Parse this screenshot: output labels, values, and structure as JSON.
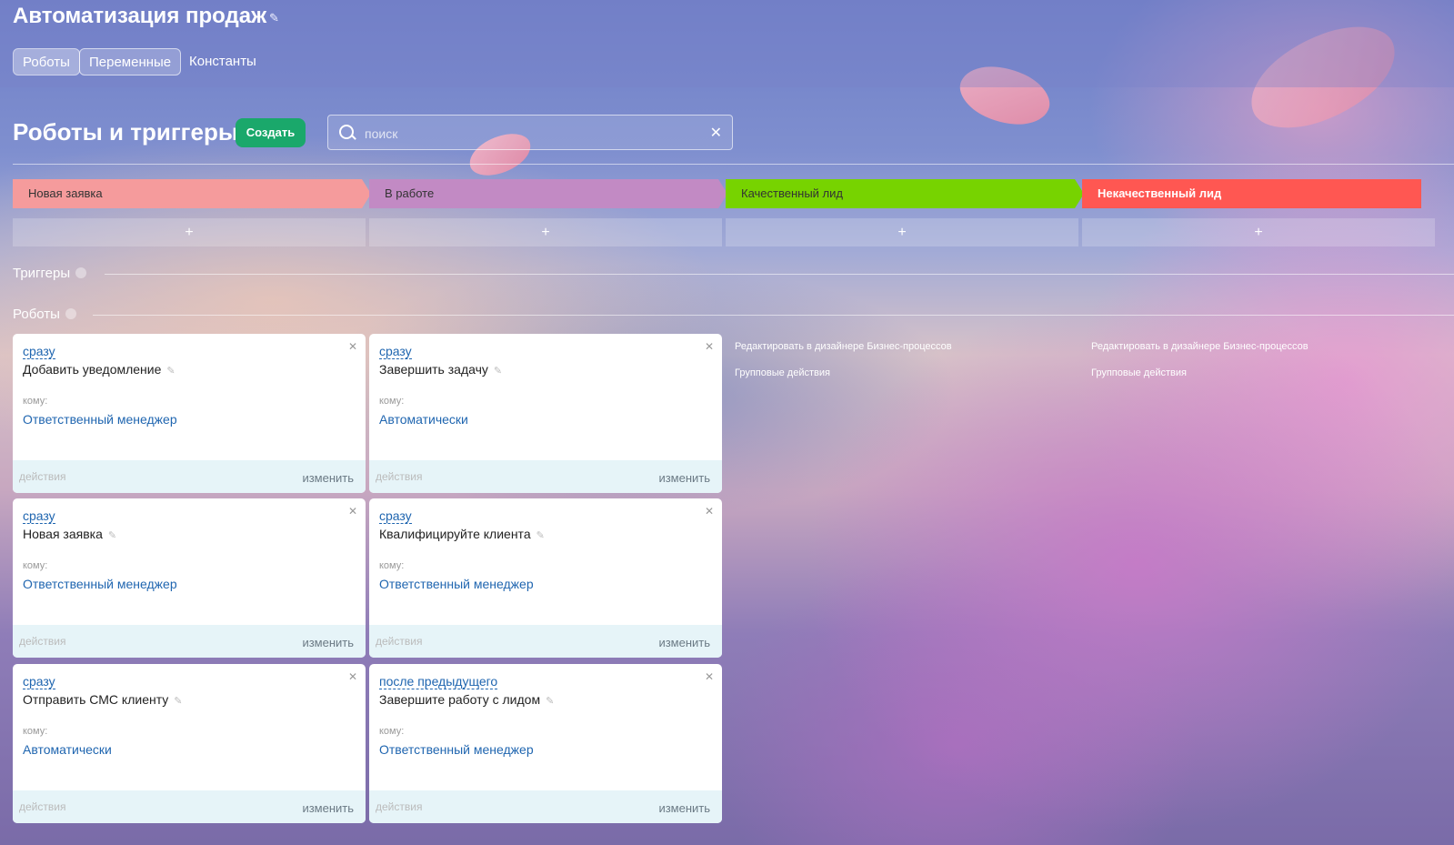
{
  "header": {
    "title": "Автоматизация продаж",
    "tabs": [
      "Роботы",
      "Переменные",
      "Константы"
    ]
  },
  "toolbar": {
    "heading": "Роботы и триггеры",
    "create_label": "Создать",
    "search_placeholder": "поиск"
  },
  "stages": [
    {
      "label": "Новая заявка",
      "color": "#f59b9c"
    },
    {
      "label": "В работе",
      "color": "#c28ac4"
    },
    {
      "label": "Качественный лид",
      "color": "#77d300"
    },
    {
      "label": "Некачественный лид",
      "color": "#ff5752"
    }
  ],
  "add_label": "+",
  "sections": {
    "triggers": "Триггеры",
    "robots": "Роботы"
  },
  "robots": [
    {
      "when": "сразу",
      "name": "Добавить уведомление",
      "to_label": "кому:",
      "to": "Ответственный менеджер"
    },
    {
      "when": "сразу",
      "name": "Завершить задачу",
      "to_label": "кому:",
      "to": "Автоматически"
    },
    {
      "when": "сразу",
      "name": "Новая заявка",
      "to_label": "кому:",
      "to": "Ответственный менеджер"
    },
    {
      "when": "сразу",
      "name": "Квалифицируйте клиента",
      "to_label": "кому:",
      "to": "Ответственный менеджер"
    },
    {
      "when": "сразу",
      "name": "Отправить СМС клиенту",
      "to_label": "кому:",
      "to": "Автоматически"
    },
    {
      "when": "после предыдущего",
      "name": "Завершите работу с лидом",
      "to_label": "кому:",
      "to": "Ответственный менеджер"
    }
  ],
  "card_footer": {
    "actions": "действия",
    "edit": "изменить"
  },
  "column_links": {
    "designer": "Редактировать в дизайнере Бизнес-процессов",
    "group": "Групповые действия"
  }
}
